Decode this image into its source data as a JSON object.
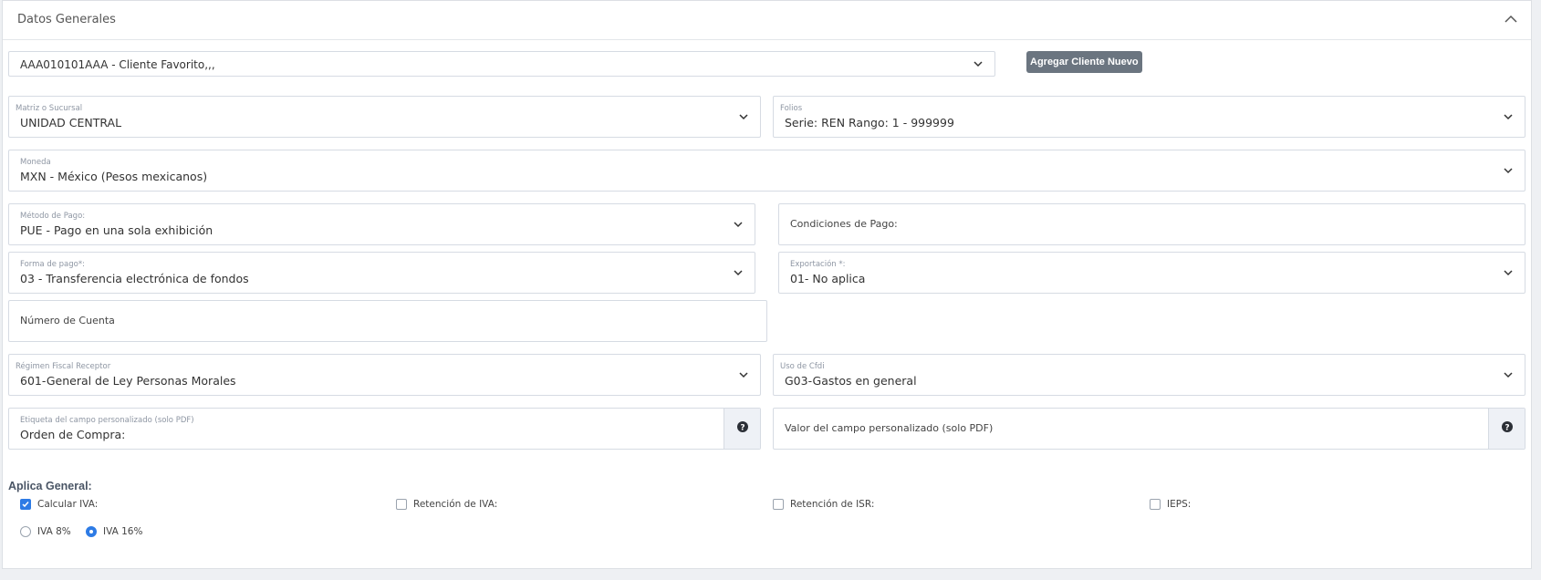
{
  "panel": {
    "title": "Datos Generales",
    "collapse_icon": "chevron-up-icon"
  },
  "client": {
    "value": "AAA010101AAA - Cliente Favorito,,,",
    "new_button": "Agregar Cliente Nuevo"
  },
  "fields": {
    "matriz": {
      "label": "Matriz o Sucursal",
      "value": "UNIDAD CENTRAL"
    },
    "folios": {
      "label": "Folios",
      "value": "Serie: REN Rango: 1 - 999999"
    },
    "moneda": {
      "label": "Moneda",
      "value": "MXN - México (Pesos mexicanos)"
    },
    "metodo_pago": {
      "label": "Método de Pago:",
      "value": "PUE - Pago en una sola exhibición"
    },
    "condiciones_pago": {
      "placeholder": "Condiciones de Pago:"
    },
    "forma_pago": {
      "label": "Forma de pago*:",
      "value": "03 - Transferencia electrónica de fondos"
    },
    "exportacion": {
      "label": "Exportación *:",
      "value": "01- No aplica"
    },
    "numero_cuenta": {
      "placeholder": "Número de Cuenta"
    },
    "regimen_fiscal": {
      "label": "Régimen Fiscal Receptor",
      "value": "601-General de Ley Personas Morales"
    },
    "uso_cfdi": {
      "label": "Uso de Cfdi",
      "value": "G03-Gastos en general"
    },
    "etiqueta_personalizada": {
      "label": "Etiqueta del campo personalizado (solo PDF)",
      "value": "Orden de Compra:"
    },
    "valor_personalizado": {
      "placeholder": "Valor del campo personalizado (solo PDF)"
    }
  },
  "aplica_general": {
    "title": "Aplica General:",
    "checkboxes": [
      {
        "label": "Calcular IVA:",
        "checked": true
      },
      {
        "label": "Retención de IVA:",
        "checked": false
      },
      {
        "label": "Retención de ISR:",
        "checked": false
      },
      {
        "label": "IEPS:",
        "checked": false
      }
    ],
    "radios": [
      {
        "label": "IVA 8%",
        "selected": false
      },
      {
        "label": "IVA 16%",
        "selected": true
      }
    ]
  },
  "colors": {
    "accent": "#2d7be5",
    "button": "#6b7580",
    "border": "#d6dbe3"
  }
}
